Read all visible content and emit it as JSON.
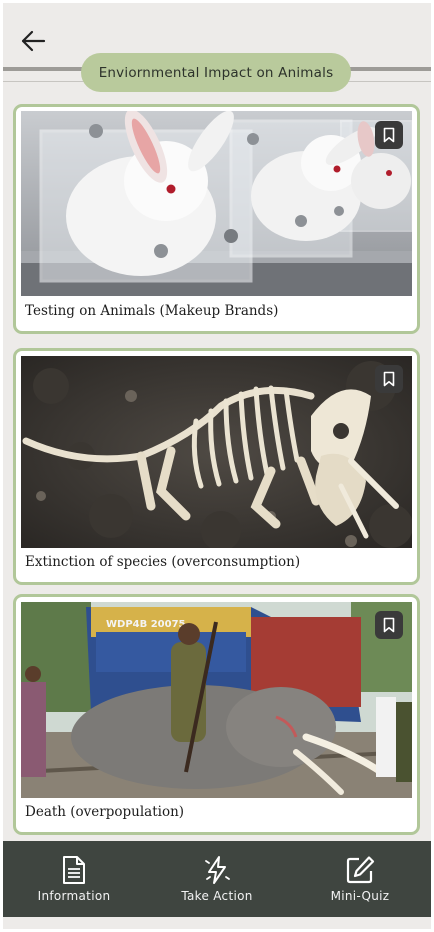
{
  "header": {
    "title": "Enviornmental Impact on Animals",
    "back_icon": "arrow-left-icon"
  },
  "cards": [
    {
      "label": "Testing on Animals (Makeup Brands)",
      "image": "rabbits-in-testing-restraints",
      "bookmark_icon": "bookmark-icon"
    },
    {
      "label": "Extinction of species (overconsumption)",
      "image": "dinosaur-skeleton-fossil",
      "bookmark_icon": "bookmark-icon"
    },
    {
      "label": "Death (overpopulation)",
      "image": "elephant-hit-by-train",
      "bookmark_icon": "bookmark-icon"
    }
  ],
  "image_text": {
    "train_number": "WDP4B 20075"
  },
  "nav": [
    {
      "label": "Information",
      "icon": "document-icon"
    },
    {
      "label": "Take Action",
      "icon": "lightning-icon"
    },
    {
      "label": "Mini-Quiz",
      "icon": "edit-icon"
    }
  ],
  "colors": {
    "background": "#edebe9",
    "accent_green": "#b1c799",
    "pill_green": "#b9ca9c",
    "nav_background": "#3f4540"
  }
}
